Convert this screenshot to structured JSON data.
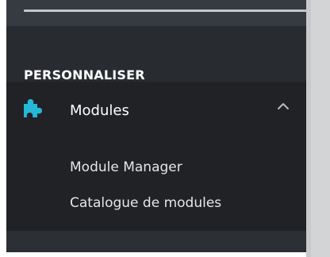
{
  "sidebar": {
    "section_heading": "PERSONNALISER",
    "menu_item": {
      "label": "Modules",
      "icon": "puzzle-piece-icon",
      "expanded": true,
      "chevron": "chevron-up-icon"
    },
    "submenu": [
      {
        "label": "Module Manager"
      },
      {
        "label": "Catalogue de modules"
      }
    ]
  },
  "colors": {
    "sidebar_bg": "#363a41",
    "section_bg": "#282b30",
    "modules_block_bg": "#202226",
    "accent_icon": "#25b9d7",
    "text_primary": "#ffffff",
    "text_secondary": "#e4e6e8",
    "panel_bg": "#d3d4d5"
  }
}
